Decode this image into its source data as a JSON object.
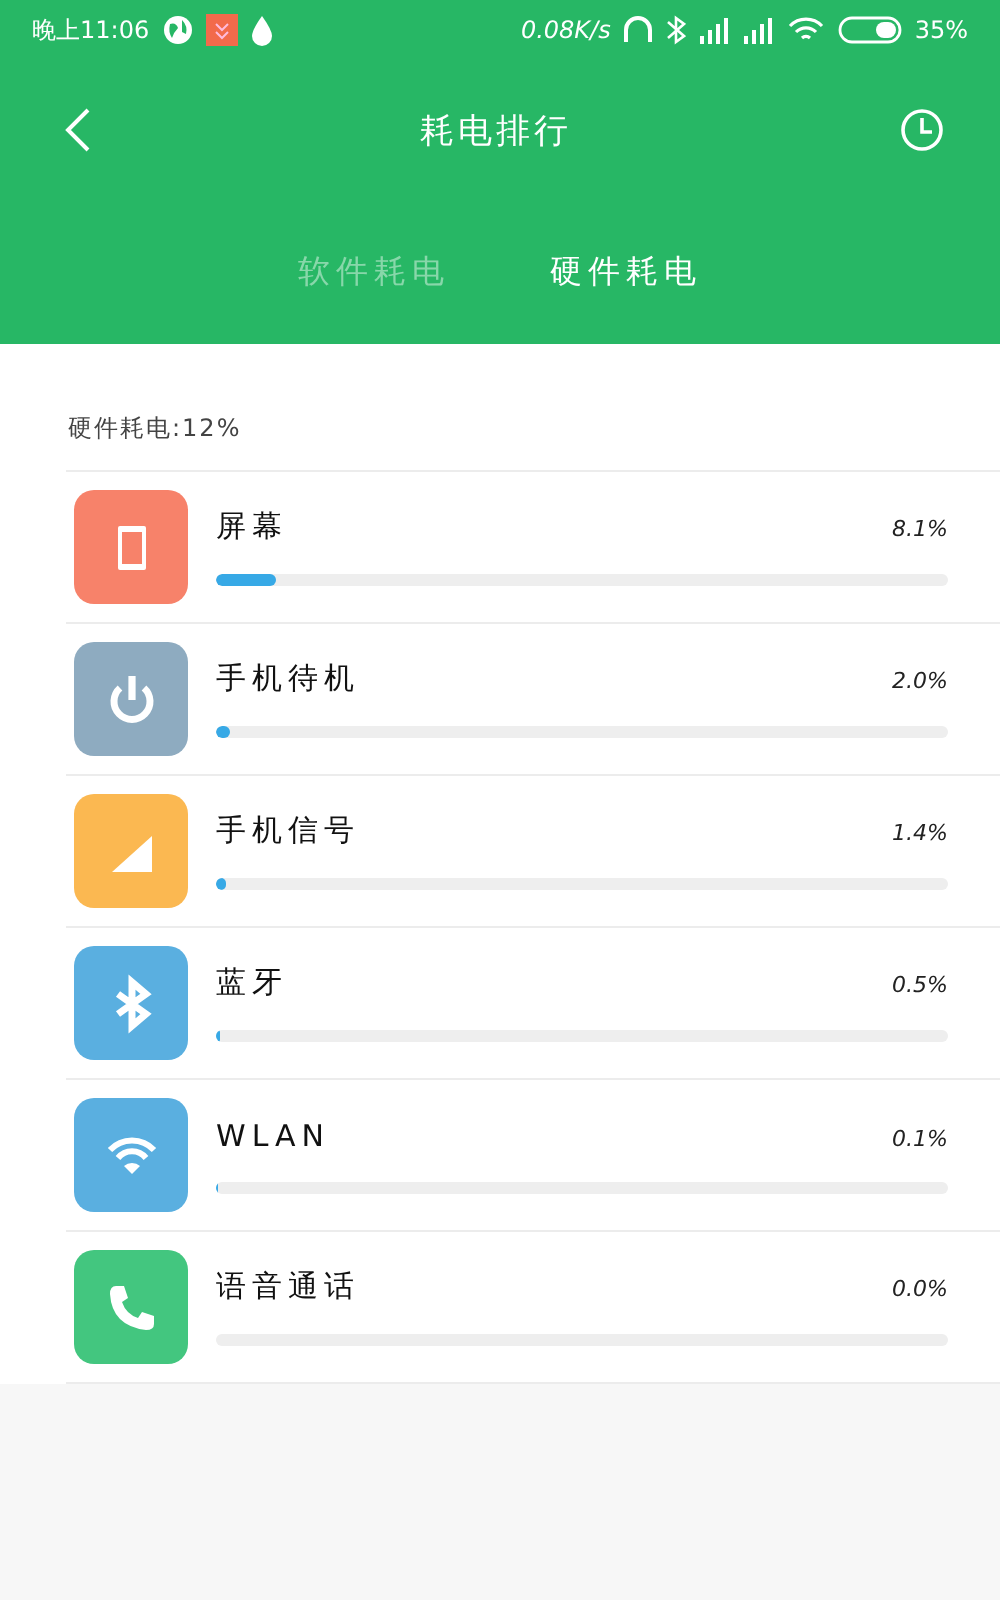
{
  "status_bar": {
    "time": "晚上11:06",
    "speed": "0.08K/s",
    "battery": "35%"
  },
  "header": {
    "title": "耗电排行"
  },
  "tabs": [
    {
      "label": "软件耗电",
      "selected": false
    },
    {
      "label": "硬件耗电",
      "selected": true
    }
  ],
  "summary": "硬件耗电:12%",
  "items": [
    {
      "kind": "screen",
      "name": "屏幕",
      "reading": "8.1%",
      "level": 0.081,
      "color": "#f7826a"
    },
    {
      "kind": "standby",
      "name": "手机待机",
      "reading": "2.0%",
      "level": 0.02,
      "color": "#8eabc0"
    },
    {
      "kind": "signal",
      "name": "手机信号",
      "reading": "1.4%",
      "level": 0.014,
      "color": "#fbb851"
    },
    {
      "kind": "bluetooth",
      "name": "蓝牙",
      "reading": "0.5%",
      "level": 0.005,
      "color": "#5aafe0"
    },
    {
      "kind": "wifi",
      "name": "WLAN",
      "reading": "0.1%",
      "level": 0.001,
      "color": "#5aafe0"
    },
    {
      "kind": "call",
      "name": "语音通话",
      "reading": "0.0%",
      "level": 0,
      "color": "#43c67f"
    }
  ]
}
